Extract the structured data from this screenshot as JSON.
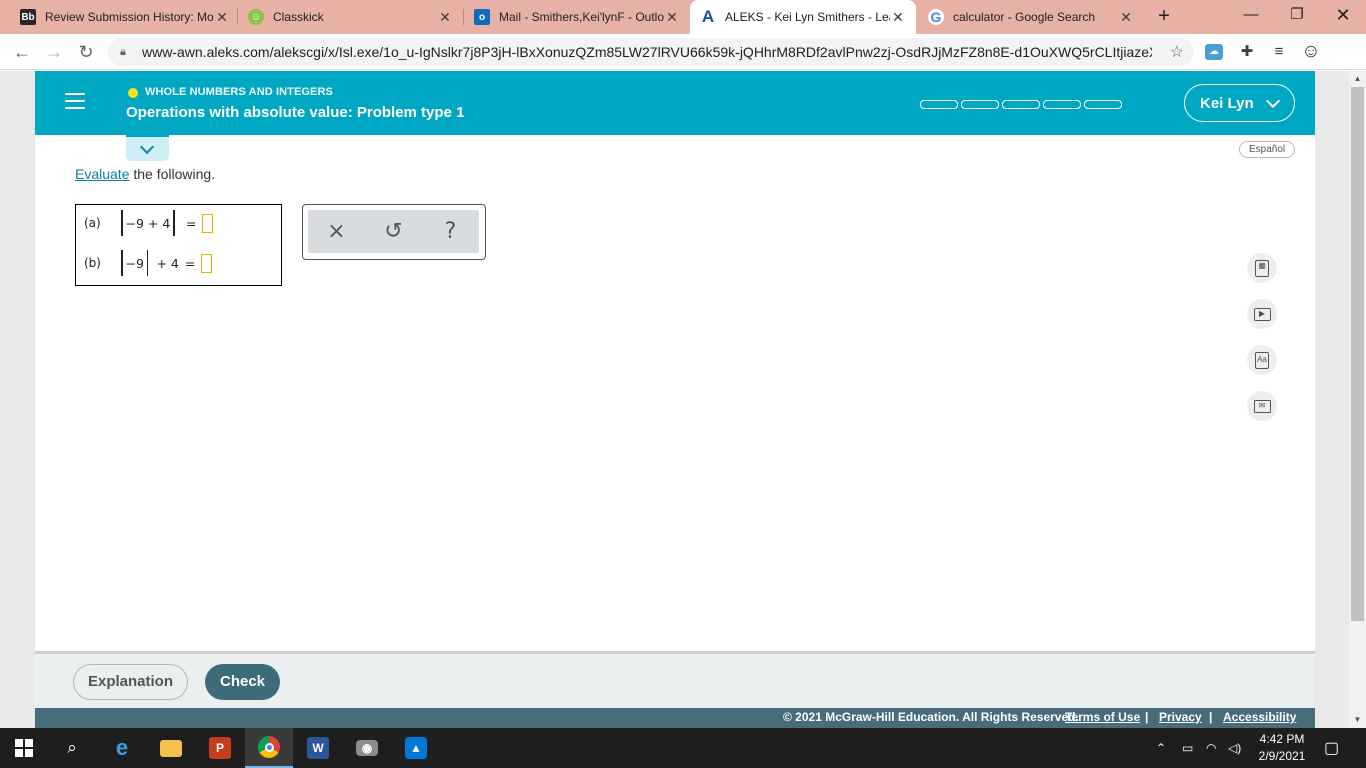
{
  "browser": {
    "tabs": [
      {
        "favicon": "blackboard-icon",
        "favicon_text": "Bb",
        "title": "Review Submission History: Mo",
        "active": false
      },
      {
        "favicon": "classkick-icon",
        "title": "Classkick",
        "active": false
      },
      {
        "favicon": "outlook-icon",
        "favicon_text": "o",
        "title": "Mail - Smithers,Kei'lynF - Outlo",
        "active": false
      },
      {
        "favicon": "aleks-icon",
        "favicon_text": "A",
        "title": "ALEKS - Kei Lyn Smithers - Lea",
        "active": true
      },
      {
        "favicon": "google-icon",
        "favicon_text": "G",
        "title": "calculator - Google Search",
        "active": false
      }
    ],
    "url": "www-awn.aleks.com/alekscgi/x/Isl.exe/1o_u-IgNslkr7j8P3jH-lBxXonuzQZm85LW27lRVU66k59k-jQHhrM8RDf2avlPnw2zj-OsdRJjMzFZ8n8E-d1OuXWQ5rCLItjiazeXL-..."
  },
  "aleks": {
    "topic": "WHOLE NUMBERS AND INTEGERS",
    "problem_title": "Operations with absolute value: Problem type 1",
    "progress_segments": 5,
    "progress_filled": 0,
    "user_name": "Kei Lyn",
    "language_toggle": "Español",
    "instruction_link": "Evaluate",
    "instruction_rest": " the following.",
    "questions": [
      {
        "label": "(a)",
        "abs_content": "−9 + 4",
        "after_abs": "",
        "equals": "="
      },
      {
        "label": "(b)",
        "abs_content": "−9",
        "after_abs": "+ 4",
        "equals": "="
      }
    ],
    "tools": {
      "clear": "×",
      "undo": "↺",
      "help": "?"
    },
    "side_tools": [
      "calculator-icon",
      "video-icon",
      "dictionary-icon",
      "mail-icon"
    ],
    "buttons": {
      "explanation": "Explanation",
      "check": "Check"
    },
    "footer": {
      "copyright": "© 2021 McGraw-Hill Education. All Rights Reserved.",
      "terms": "Terms of Use",
      "privacy": "Privacy",
      "accessibility": "Accessibility",
      "sep": "|"
    }
  },
  "taskbar": {
    "time": "4:42 PM",
    "date": "2/9/2021"
  },
  "colors": {
    "header": "#00a7c3",
    "check_button": "#3e6b7a",
    "footer": "#486c79",
    "tabstrip": "#e8b1a6"
  }
}
